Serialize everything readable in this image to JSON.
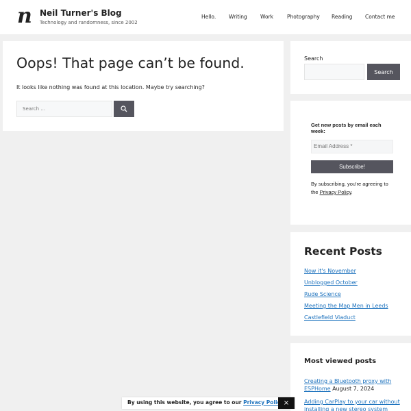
{
  "header": {
    "logo_glyph": "n",
    "site_title": "Neil Turner's Blog",
    "tagline": "Technology and randomness, since 2002",
    "nav": [
      "Hello.",
      "Writing",
      "Work",
      "Photography",
      "Reading",
      "Contact me"
    ]
  },
  "main": {
    "title": "Oops! That page can’t be found.",
    "text": "It looks like nothing was found at this location. Maybe try searching?",
    "search_placeholder": "Search …",
    "search_icon": "search-icon"
  },
  "sidebar": {
    "search": {
      "label": "Search",
      "button": "Search"
    },
    "subscribe": {
      "heading": "Get new posts by email each week:",
      "email_placeholder": "Email Address *",
      "button": "Subscribe!",
      "note_prefix": "By subscribing, you're agreeing to the ",
      "note_link": "Privacy Policy",
      "note_suffix": "."
    },
    "recent": {
      "title": "Recent Posts",
      "items": [
        "Now it's November",
        "Unblogged October",
        "Rude Science",
        "Meeting the Map Men in Leeds",
        "Castlefield Viaduct"
      ]
    },
    "most_viewed": {
      "title": "Most viewed posts",
      "items": [
        {
          "title": "Creating a Bluetooth proxy with ESPHome",
          "date": "August 7, 2024"
        },
        {
          "title": "Adding CarPlay to your car without installing a new stereo system",
          "date": ""
        }
      ]
    }
  },
  "cookie": {
    "text": "By using this website, you agree to our ",
    "link": "Privacy Policy",
    "close": "×"
  },
  "colors": {
    "accent": "#55555e",
    "link": "#1e73be",
    "background": "#f0f0f0"
  }
}
